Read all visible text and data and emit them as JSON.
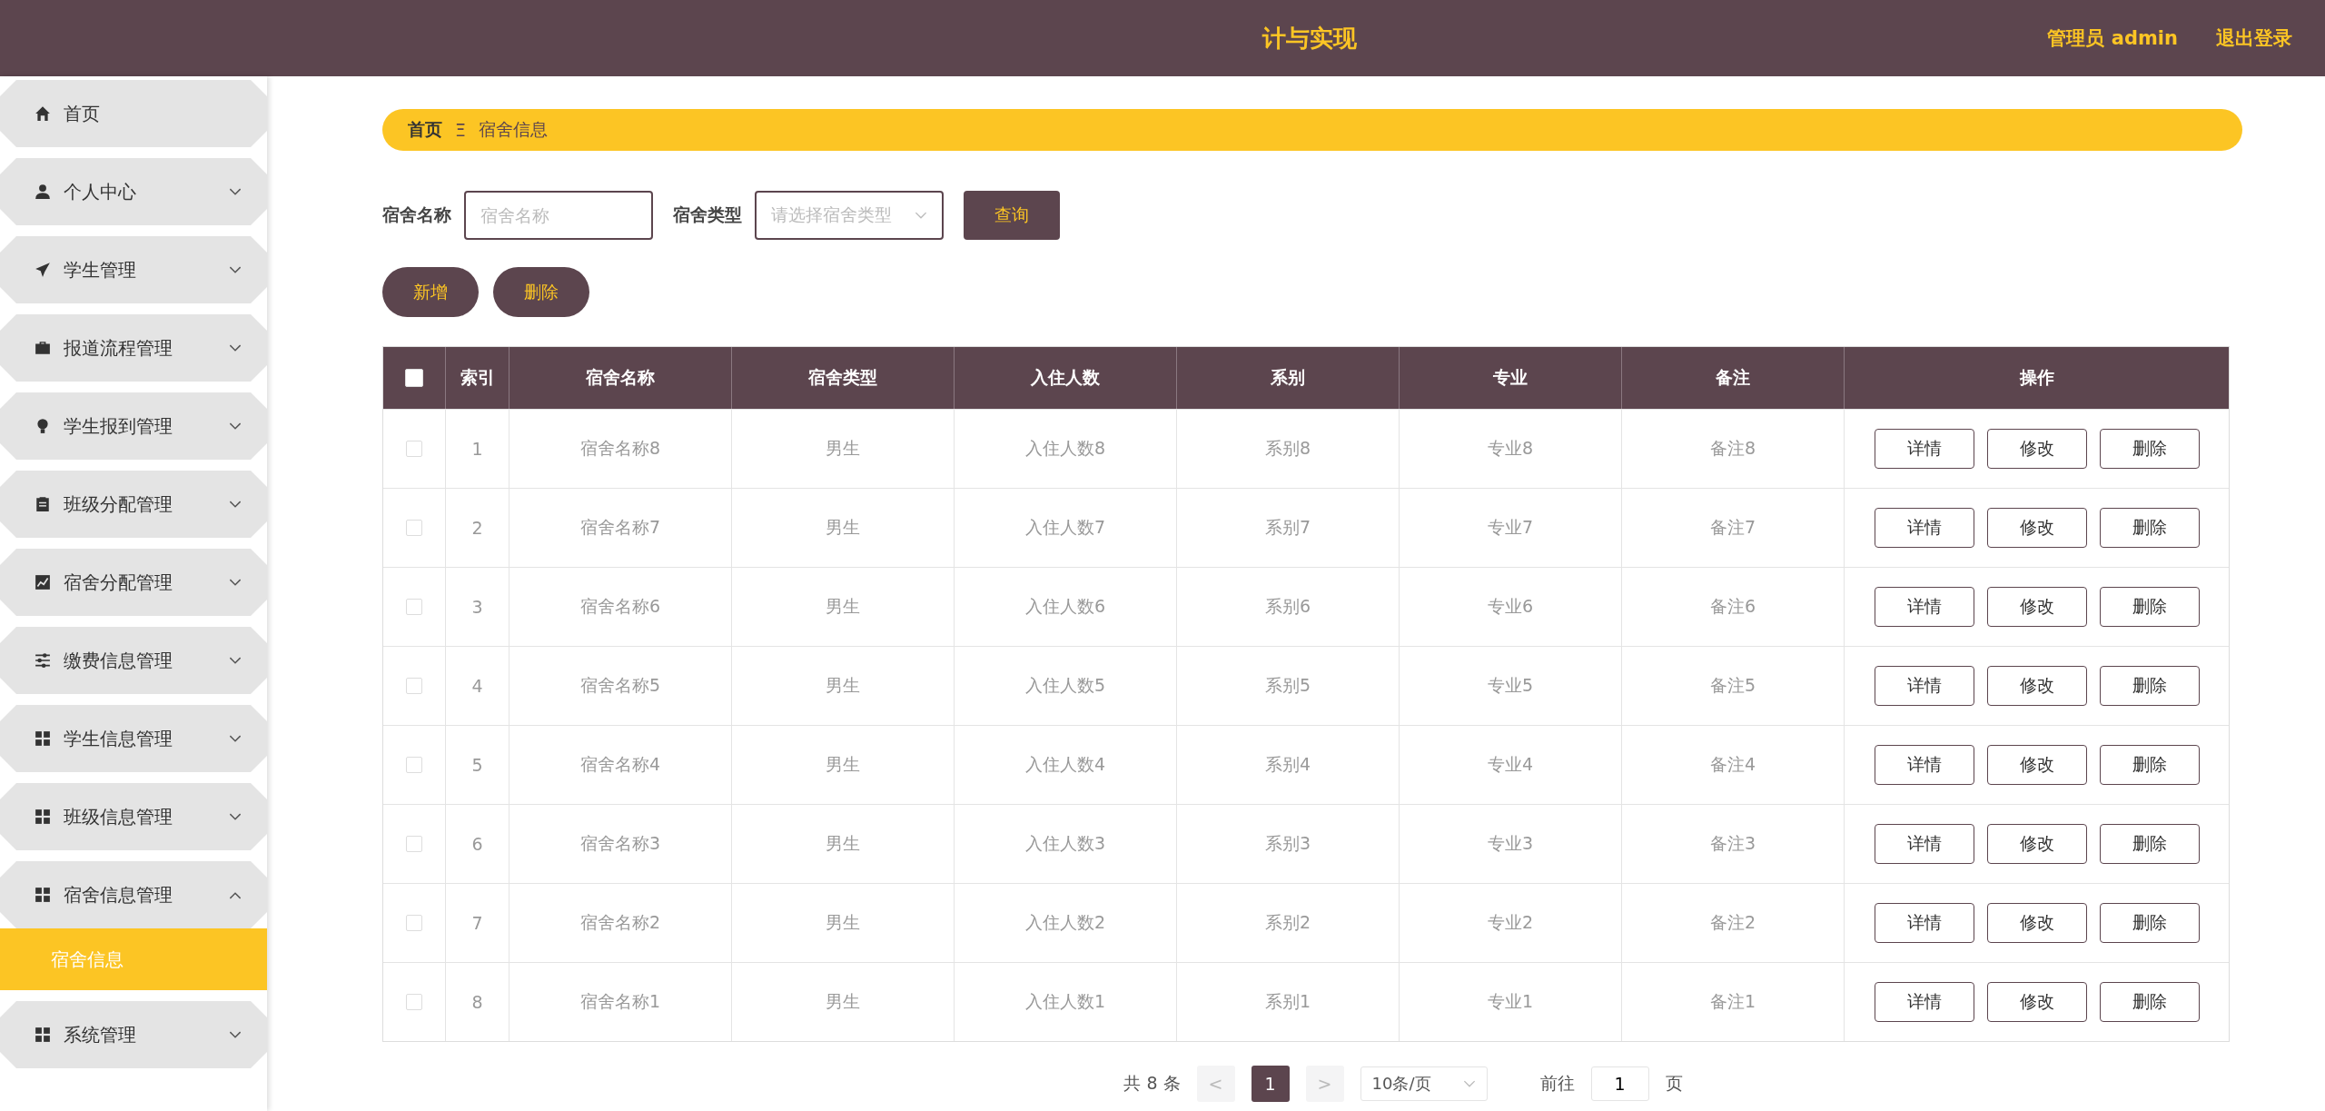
{
  "header": {
    "title": "计与实现",
    "user": "管理员 admin",
    "logout": "退出登录"
  },
  "sidebar": {
    "items": [
      {
        "label": "首页",
        "kind": "home",
        "expandable": false
      },
      {
        "label": "个人中心",
        "kind": "user",
        "expandable": true,
        "expanded": false
      },
      {
        "label": "学生管理",
        "kind": "plane",
        "expandable": true,
        "expanded": false
      },
      {
        "label": "报道流程管理",
        "kind": "briefcase",
        "expandable": true,
        "expanded": false
      },
      {
        "label": "学生报到管理",
        "kind": "bulb",
        "expandable": true,
        "expanded": false
      },
      {
        "label": "班级分配管理",
        "kind": "clipboard",
        "expandable": true,
        "expanded": false
      },
      {
        "label": "宿舍分配管理",
        "kind": "chart",
        "expandable": true,
        "expanded": false
      },
      {
        "label": "缴费信息管理",
        "kind": "sliders",
        "expandable": true,
        "expanded": false
      },
      {
        "label": "学生信息管理",
        "kind": "grid",
        "expandable": true,
        "expanded": false
      },
      {
        "label": "班级信息管理",
        "kind": "grid",
        "expandable": true,
        "expanded": false
      },
      {
        "label": "宿舍信息管理",
        "kind": "grid",
        "expandable": true,
        "expanded": true,
        "children": [
          {
            "label": "宿舍信息",
            "selected": true
          }
        ]
      },
      {
        "label": "系统管理",
        "kind": "grid",
        "expandable": true,
        "expanded": false
      }
    ]
  },
  "breadcrumb": {
    "items": [
      "首页",
      "宿舍信息"
    ],
    "separator": "Ξ"
  },
  "search": {
    "fields": [
      {
        "label": "宿舍名称",
        "kind": "text",
        "placeholder": "宿舍名称"
      },
      {
        "label": "宿舍类型",
        "kind": "select",
        "placeholder": "请选择宿舍类型"
      }
    ],
    "button": "查询"
  },
  "actions": [
    "新增",
    "删除"
  ],
  "table": {
    "select_all_checked": false,
    "columns": [
      "索引",
      "宿舍名称",
      "宿舍类型",
      "入住人数",
      "系别",
      "专业",
      "备注",
      "操作"
    ],
    "rows": [
      {
        "checked": false,
        "cells": [
          "1",
          "宿舍名称8",
          "男生",
          "入住人数8",
          "系别8",
          "专业8",
          "备注8"
        ],
        "buttons": [
          "详情",
          "修改",
          "删除"
        ]
      },
      {
        "checked": false,
        "cells": [
          "2",
          "宿舍名称7",
          "男生",
          "入住人数7",
          "系别7",
          "专业7",
          "备注7"
        ],
        "buttons": [
          "详情",
          "修改",
          "删除"
        ]
      },
      {
        "checked": false,
        "cells": [
          "3",
          "宿舍名称6",
          "男生",
          "入住人数6",
          "系别6",
          "专业6",
          "备注6"
        ],
        "buttons": [
          "详情",
          "修改",
          "删除"
        ]
      },
      {
        "checked": false,
        "cells": [
          "4",
          "宿舍名称5",
          "男生",
          "入住人数5",
          "系别5",
          "专业5",
          "备注5"
        ],
        "buttons": [
          "详情",
          "修改",
          "删除"
        ]
      },
      {
        "checked": false,
        "cells": [
          "5",
          "宿舍名称4",
          "男生",
          "入住人数4",
          "系别4",
          "专业4",
          "备注4"
        ],
        "buttons": [
          "详情",
          "修改",
          "删除"
        ]
      },
      {
        "checked": false,
        "cells": [
          "6",
          "宿舍名称3",
          "男生",
          "入住人数3",
          "系别3",
          "专业3",
          "备注3"
        ],
        "buttons": [
          "详情",
          "修改",
          "删除"
        ]
      },
      {
        "checked": false,
        "cells": [
          "7",
          "宿舍名称2",
          "男生",
          "入住人数2",
          "系别2",
          "专业2",
          "备注2"
        ],
        "buttons": [
          "详情",
          "修改",
          "删除"
        ]
      },
      {
        "checked": false,
        "cells": [
          "8",
          "宿舍名称1",
          "男生",
          "入住人数1",
          "系别1",
          "专业1",
          "备注1"
        ],
        "buttons": [
          "详情",
          "修改",
          "删除"
        ]
      }
    ]
  },
  "pagination": {
    "total": "共 8 条",
    "prev": "<",
    "pages": [
      {
        "label": "1",
        "selected": true
      }
    ],
    "next": ">",
    "page_size": "10条/页",
    "goto_label": "前往",
    "goto_value": "1",
    "goto_suffix": "页"
  }
}
